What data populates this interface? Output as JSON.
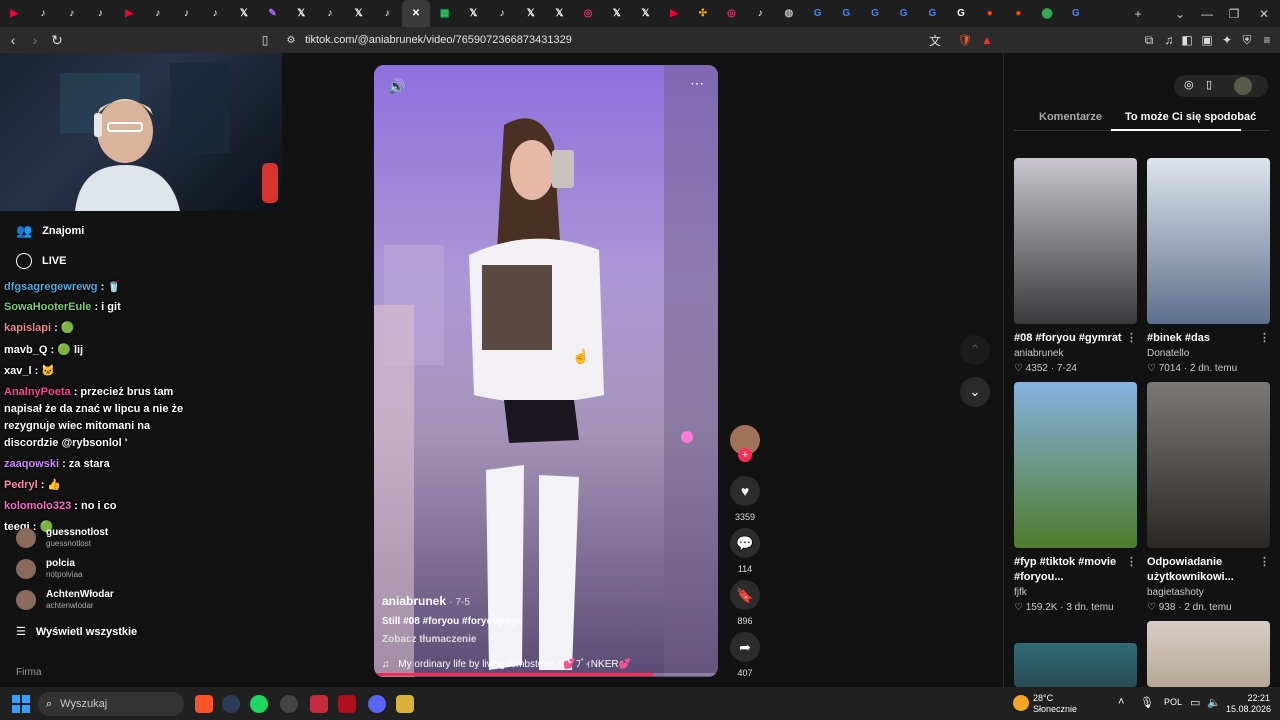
{
  "browser": {
    "tabs": [
      {
        "icon": "youtube-icon",
        "color": "#ff0033"
      },
      {
        "icon": "tiktok-icon",
        "color": "#ffffff"
      },
      {
        "icon": "tiktok-icon",
        "color": "#ffffff"
      },
      {
        "icon": "tiktok-icon",
        "color": "#ffffff"
      },
      {
        "icon": "youtube-icon",
        "color": "#ff0033"
      },
      {
        "icon": "tiktok-icon",
        "color": "#ffffff"
      },
      {
        "icon": "tiktok-icon",
        "color": "#ffffff"
      },
      {
        "icon": "tiktok-icon",
        "color": "#ffffff"
      },
      {
        "icon": "x-icon",
        "color": "#ffffff"
      },
      {
        "icon": "feather-icon",
        "color": "#b266ff"
      },
      {
        "icon": "x-icon",
        "color": "#ffffff"
      },
      {
        "icon": "tiktok-icon",
        "color": "#ffffff"
      },
      {
        "icon": "x-icon",
        "color": "#ffffff"
      },
      {
        "icon": "tiktok-icon",
        "color": "#ffffff"
      },
      {
        "icon": "close-icon",
        "color": "#ffffff",
        "active": true
      },
      {
        "icon": "sheets-icon",
        "color": "#22c55e"
      },
      {
        "icon": "x-icon",
        "color": "#ffffff"
      },
      {
        "icon": "tiktok-icon",
        "color": "#ffffff"
      },
      {
        "icon": "x-icon",
        "color": "#ffffff"
      },
      {
        "icon": "x-icon",
        "color": "#ffffff"
      },
      {
        "icon": "instagram-icon",
        "color": "#e1306c"
      },
      {
        "icon": "x-icon",
        "color": "#ffffff"
      },
      {
        "icon": "x-icon",
        "color": "#ffffff"
      },
      {
        "icon": "youtube-icon",
        "color": "#ff0033"
      },
      {
        "icon": "pinwheel-icon",
        "color": "#f5a623"
      },
      {
        "icon": "instagram-icon",
        "color": "#e1306c"
      },
      {
        "icon": "tiktok-icon",
        "color": "#ffffff"
      },
      {
        "icon": "globe-icon",
        "color": "#bbbbbb"
      },
      {
        "icon": "google-icon",
        "color": "#4285f4"
      },
      {
        "icon": "google-icon",
        "color": "#4285f4"
      },
      {
        "icon": "google-icon",
        "color": "#4285f4"
      },
      {
        "icon": "google-icon",
        "color": "#4285f4"
      },
      {
        "icon": "google-icon",
        "color": "#4285f4"
      },
      {
        "icon": "google-icon",
        "color": "#ffffff"
      },
      {
        "icon": "reddit-icon",
        "color": "#ff4500"
      },
      {
        "icon": "reddit-icon",
        "color": "#ff4500"
      },
      {
        "icon": "maps-icon",
        "color": "#34a853"
      },
      {
        "icon": "google-icon",
        "color": "#4285f4"
      }
    ],
    "new_tab": "+",
    "url": "tiktok.com/@aniabrunek/video/7659072366873431329"
  },
  "stream_chat": [
    {
      "user": "",
      "text": "",
      "color": "#7cf"
    },
    {
      "user": "dfgsagregewrewg",
      "text": " : 🥤",
      "color": "#5ad"
    },
    {
      "user": "SowaHooterEule",
      "text": " : i git",
      "color": "#7c7"
    },
    {
      "user": "kapislapi",
      "text": " : 🟢",
      "color": "#e88"
    },
    {
      "user": "mavb_Q",
      "text": " : 🟢 lij",
      "color": "#fff"
    },
    {
      "user": "xav_l",
      "text": " : 🐱",
      "color": "#fff"
    },
    {
      "user": "AnalnyPoeta",
      "text": " : przecież brus tam",
      "color": "#f49"
    },
    {
      "user": "",
      "text": "napisał że da znać w lipcu a nie że",
      "color": "#fff"
    },
    {
      "user": "",
      "text": "rezygnuje wiec mitomani na",
      "color": "#fff"
    },
    {
      "user": "",
      "text": "discordzie @rybsonlol '",
      "color": "#fff"
    },
    {
      "user": "zaaqowski",
      "text": " : za stara",
      "color": "#c8f"
    },
    {
      "user": "Pedryl",
      "text": " : 👍",
      "color": "#f8a"
    },
    {
      "user": "kolomolo323",
      "text": " : no i co",
      "color": "#f6c"
    },
    {
      "user": "teeqi",
      "text": " : 🟢",
      "color": "#fff"
    }
  ],
  "leftnav": {
    "znajomi": "Znajomi",
    "live": "LIVE",
    "following": [
      {
        "name": "guessnotlost",
        "handle": "guessnotlost"
      },
      {
        "name": "polcia",
        "handle": "notpolviaa"
      },
      {
        "name": "AchtenWłodar",
        "handle": "achtenwlodar"
      }
    ],
    "show_all": "Wyświetl wszystkie",
    "firma": "Firma"
  },
  "video": {
    "author": "aniabrunek",
    "date": "· 7-5",
    "caption": "Still #08 #foryou #foryoupage",
    "translate": "Zobacz tłumaczenie",
    "music": "My ordinary life by living tombstone - 💕ﾌﾞｨNKER💕",
    "progress": 0.81,
    "likes": "3359",
    "comments": "114",
    "saves": "896",
    "shares": "407"
  },
  "right": {
    "tab_comments": "Komentarze",
    "tab_suggested": "To może Ci się spodobać",
    "cards": [
      {
        "title": "#08 #foryou #gymrat",
        "title2": "",
        "author": "aniabrunek",
        "likes": "4352",
        "date": "7-24",
        "c1": "#c8c6cc",
        "c2": "#3a3a3c"
      },
      {
        "title": "#binek #das",
        "title2": "",
        "author": "Donatello",
        "likes": "7014",
        "date": "2 dn. temu",
        "c1": "#dfe4ee",
        "c2": "#5d6f8c"
      },
      {
        "title": "#fyp #tiktok #movie",
        "title2": "#foryou...",
        "author": "fjfk",
        "likes": "159.2K",
        "date": "3 dn. temu",
        "c1": "#86b3e0",
        "c2": "#4f7b2c"
      },
      {
        "title": "Odpowiadanie",
        "title2": "użytkownikowi...",
        "author": "bagietashoty",
        "likes": "938",
        "date": "2 dn. temu",
        "c1": "#7b7875",
        "c2": "#2a2725"
      }
    ]
  },
  "taskbar": {
    "search": "Wyszukaj",
    "weather_temp": "28°C",
    "weather_desc": "Słonecznie",
    "lang": "POL",
    "time": "22:21",
    "date": "15.08.2026"
  }
}
